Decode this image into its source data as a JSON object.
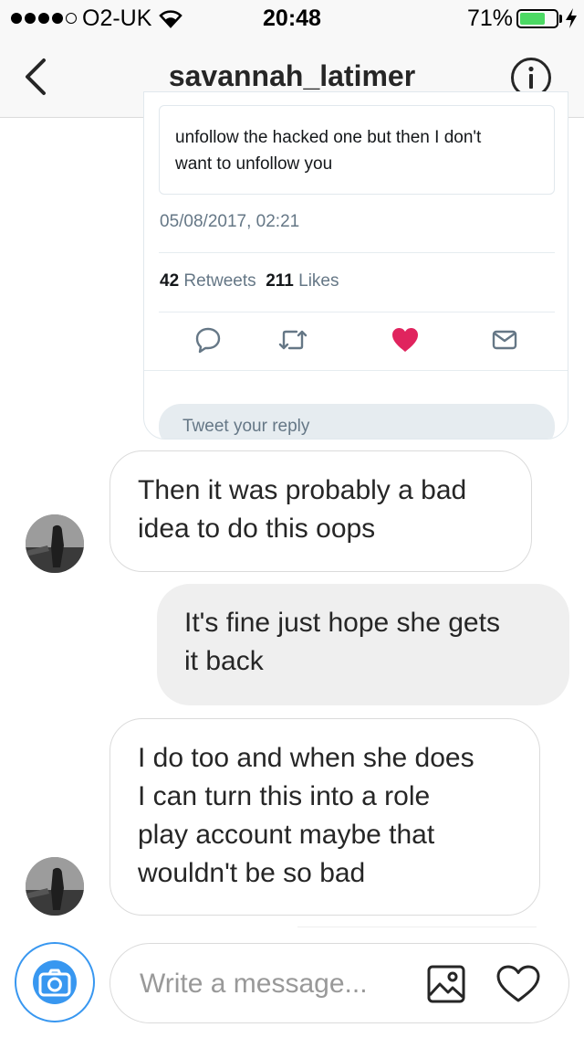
{
  "status_bar": {
    "carrier": "O2-UK",
    "time": "20:48",
    "battery_percent": "71%",
    "battery_level": 0.71,
    "signal_bars": 4
  },
  "header": {
    "title": "savannah_latimer",
    "back_icon": "chevron-left-icon",
    "info_icon": "info-icon"
  },
  "tweet": {
    "quoted_line1": "unfollow the hacked one but then I don't",
    "quoted_line2": "want to unfollow you",
    "date": "05/08/2017, 02:21",
    "retweets_count": "42",
    "retweets_label": "Retweets",
    "likes_count": "211",
    "likes_label": "Likes",
    "reply_placeholder": "Tweet your reply",
    "actions": [
      "reply-icon",
      "retweet-icon",
      "heart-icon",
      "mail-icon"
    ]
  },
  "messages": [
    {
      "direction": "incoming",
      "line1": "Then it was probably a bad",
      "line2": "idea to do this oops"
    },
    {
      "direction": "outgoing",
      "line1": "It's fine just hope she gets",
      "line2": "it back"
    },
    {
      "direction": "incoming",
      "line1": "I do too and when she does",
      "line2": "I can turn this into a role",
      "line3": "play account maybe that",
      "line4": "wouldn't be so bad"
    }
  ],
  "composer": {
    "placeholder": "Write a message...",
    "camera_icon": "camera-icon",
    "gallery_icon": "gallery-icon",
    "like_icon": "heart-outline-icon"
  },
  "colors": {
    "accent": "#3897f0",
    "like": "#e0245e",
    "battery": "#4cd964"
  }
}
